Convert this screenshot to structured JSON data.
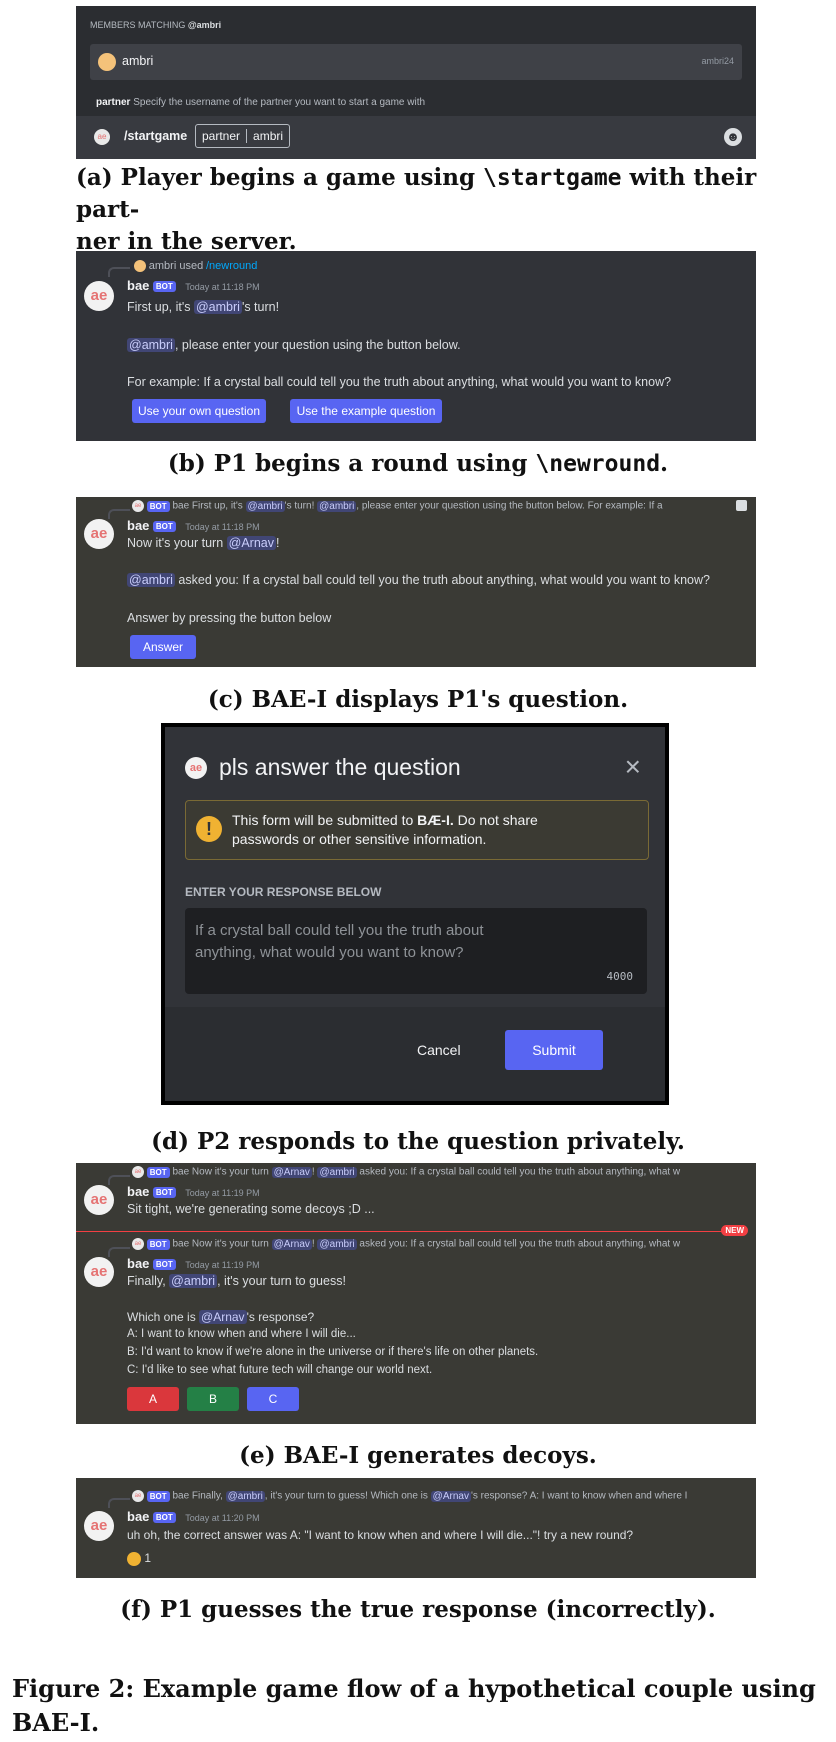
{
  "panel_a": {
    "header_prefix": "MEMBERS MATCHING",
    "header_query": "@ambri",
    "member_name": "ambri",
    "member_tag": "ambri24",
    "option_name": "partner",
    "option_desc": "Specify the username of the partner you want to start a game with",
    "command": "/startgame",
    "param_label": "partner",
    "param_value": "ambri",
    "avatar_text": "ae",
    "emoji_icon": "smiley-icon"
  },
  "caption_a": "(a) Player begins a game using \\startgame with their partner in the server.",
  "caption_a_l1_pre": "(a) Player begins a game using ",
  "caption_a_l1_code": "\\startgame",
  "caption_a_l1_post": " with their part-",
  "caption_a_l2": "ner in the server.",
  "panel_b": {
    "reply_user": "ambri used",
    "reply_cmd": "/newround",
    "bot_name": "bae",
    "bot_badge": "BOT",
    "timestamp": "Today at 11:18 PM",
    "l1_pre": "First up, it's ",
    "l1_mention": "@ambri",
    "l1_post": "'s turn!",
    "l2_mention": "@ambri",
    "l2_post": ", please enter your question using the button below.",
    "l3": "For example: If a crystal ball could tell you the truth about anything, what would you want to know?",
    "btn1": "Use your own question",
    "btn2": "Use the example question"
  },
  "caption_b_pre": "(b) P1 begins a round using ",
  "caption_b_code": "\\newround",
  "caption_b_post": ".",
  "panel_c": {
    "reply_badge": "BOT",
    "reply_text_a": "bae First up, it's ",
    "reply_m1": "@ambri",
    "reply_text_b": "'s turn! ",
    "reply_m2": "@ambri",
    "reply_text_c": ", please enter your question using the button below. For example: If a",
    "bot_name": "bae",
    "bot_badge": "BOT",
    "timestamp": "Today at 11:18 PM",
    "l1_pre": "Now it's your turn ",
    "l1_mention": "@Arnav",
    "l1_post": "!",
    "l2_mention": "@ambri",
    "l2_post": " asked you: If a crystal ball could tell you the truth about anything, what would you want to know?",
    "l3": "Answer by pressing the button below",
    "btn": "Answer"
  },
  "caption_c": "(c) BAE-I displays P1's question.",
  "panel_d": {
    "title": "pls answer the question",
    "warning_l1_pre": "This form will be submitted to ",
    "warning_l1_bold": "BÆ-I.",
    "warning_l1_post": " Do not share",
    "warning_l2": "passwords or other sensitive information.",
    "label": "ENTER YOUR RESPONSE BELOW",
    "placeholder_l1": "If a crystal ball could tell you the truth about",
    "placeholder_l2": "anything, what would you want to know?",
    "char_limit": "4000",
    "cancel": "Cancel",
    "submit": "Submit"
  },
  "caption_d": "(d) P2 responds to the question privately.",
  "panel_e": {
    "reply1_badge": "BOT",
    "reply1_a": "bae Now it's your turn ",
    "reply1_m1": "@Arnav",
    "reply1_b": "! ",
    "reply1_m2": "@ambri",
    "reply1_c": " asked you: If a crystal ball could tell you the truth about anything, what w",
    "bot_name": "bae",
    "bot_badge": "BOT",
    "timestamp1": "Today at 11:19 PM",
    "msg1": "Sit tight, we're generating some decoys ;D ...",
    "new_badge": "NEW",
    "reply2_badge": "BOT",
    "reply2_a": "bae Now it's your turn ",
    "reply2_m1": "@Arnav",
    "reply2_b": "! ",
    "reply2_m2": "@ambri",
    "reply2_c": " asked you: If a crystal ball could tell you the truth about anything, what w",
    "timestamp2": "Today at 11:19 PM",
    "l1_pre": "Finally, ",
    "l1_mention": "@ambri",
    "l1_post": ", it's your turn to guess!",
    "l2_pre": "Which one is ",
    "l2_mention": "@Arnav",
    "l2_post": "'s response?",
    "optA": "A: I want to know when and where I will die...",
    "optB": "B: I'd want to know if we're alone in the universe or if there's life on other planets.",
    "optC": "C: I'd like to see what future tech will change our world next.",
    "btnA": "A",
    "btnB": "B",
    "btnC": "C"
  },
  "caption_e": "(e) BAE-I generates decoys.",
  "panel_f": {
    "reply_badge": "BOT",
    "reply_a": "bae Finally, ",
    "reply_m1": "@ambri",
    "reply_b": ", it's your turn to guess! Which one is ",
    "reply_m2": "@Arnav",
    "reply_c": "'s response? A: I want to know when and where I",
    "bot_name": "bae",
    "bot_badge": "BOT",
    "timestamp": "Today at 11:20 PM",
    "msg": "uh oh, the correct answer was A:  \"I want to know when and where I will die...\"! try a new round?",
    "reaction_count": "1"
  },
  "caption_f": "(f) P1 guesses the true response (incorrectly).",
  "figure_caption_l1": "Figure 2: Example game flow of a hypothetical couple using",
  "figure_caption_l2": "BAE-I.",
  "colors": {
    "discord_bg": "#313338",
    "blurple": "#5865f2",
    "green": "#248046",
    "red": "#da373c"
  }
}
